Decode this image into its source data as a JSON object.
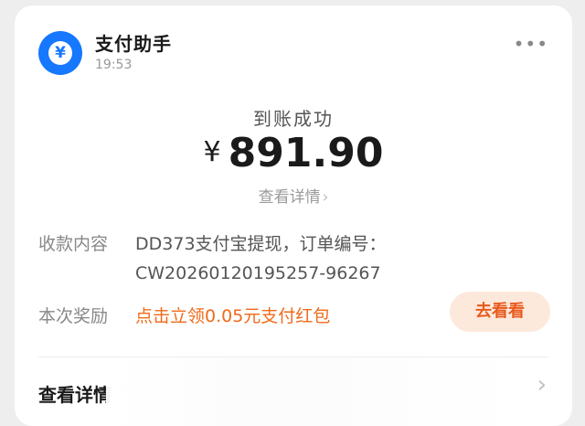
{
  "notification": {
    "sender": "支付助手",
    "time": "19:53",
    "more_icon": "•••",
    "avatar_glyph": "¥"
  },
  "payment": {
    "status": "到账成功",
    "currency": "¥",
    "amount": "891.90",
    "detail_link": "查看详情",
    "detail_chevron": "›"
  },
  "fields": {
    "content_label": "收款内容",
    "content_line1": "DD373支付宝提现，订单编号：",
    "content_line2": "CW20260120195257-96267",
    "reward_label": "本次奖励",
    "reward_value": "点击立领0.05元支付红包",
    "reward_button": "去看看"
  },
  "footer": {
    "link": "查看详情",
    "chevron": "›"
  },
  "colors": {
    "brand_blue": "#1677ff",
    "reward_orange": "#f06a1a",
    "pill_bg": "#fde9dc"
  }
}
